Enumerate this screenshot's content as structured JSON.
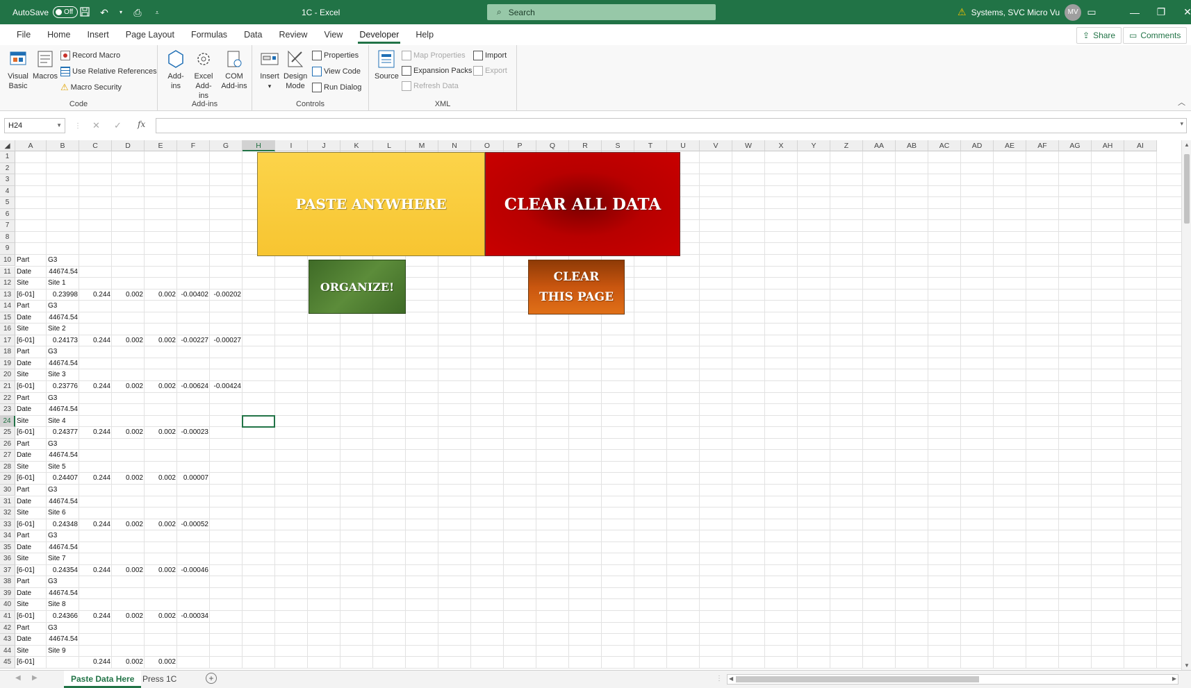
{
  "titlebar": {
    "autosave_label": "AutoSave",
    "autosave_state": "Off",
    "doc_title": "1C  -  Excel",
    "search_placeholder": "Search",
    "account_name": "Systems, SVC Micro Vu",
    "avatar_initials": "MV"
  },
  "menu": {
    "tabs": [
      "File",
      "Home",
      "Insert",
      "Page Layout",
      "Formulas",
      "Data",
      "Review",
      "View",
      "Developer",
      "Help"
    ],
    "active_tab": "Developer",
    "share_label": "Share",
    "comments_label": "Comments"
  },
  "ribbon": {
    "code": {
      "label": "Code",
      "visual_basic": "Visual Basic",
      "macros": "Macros",
      "record_macro": "Record Macro",
      "use_relative": "Use Relative References",
      "macro_security": "Macro Security"
    },
    "addins": {
      "label": "Add-ins",
      "addins": "Add-ins",
      "excel_addins": "Excel Add-ins",
      "com_addins": "COM Add-ins"
    },
    "controls": {
      "label": "Controls",
      "insert": "Insert",
      "design_mode": "Design Mode",
      "properties": "Properties",
      "view_code": "View Code",
      "run_dialog": "Run Dialog"
    },
    "xml": {
      "label": "XML",
      "source": "Source",
      "map_properties": "Map Properties",
      "expansion_packs": "Expansion Packs",
      "refresh_data": "Refresh Data",
      "import": "Import",
      "export": "Export"
    }
  },
  "formula_bar": {
    "name_box": "H24",
    "fx_label": "fx",
    "formula": ""
  },
  "columns": [
    "A",
    "B",
    "C",
    "D",
    "E",
    "F",
    "G",
    "H",
    "I",
    "J",
    "K",
    "L",
    "M",
    "N",
    "O",
    "P",
    "Q",
    "R",
    "S",
    "T",
    "U",
    "V",
    "W",
    "X",
    "Y",
    "Z",
    "AA",
    "AB",
    "AC",
    "AD",
    "AE",
    "AF",
    "AG",
    "AH",
    "AI"
  ],
  "selected_cell": {
    "col": "H",
    "row": 24
  },
  "rows": [
    {
      "n": 1,
      "cells": []
    },
    {
      "n": 2,
      "cells": []
    },
    {
      "n": 3,
      "cells": []
    },
    {
      "n": 4,
      "cells": []
    },
    {
      "n": 5,
      "cells": []
    },
    {
      "n": 6,
      "cells": []
    },
    {
      "n": 7,
      "cells": []
    },
    {
      "n": 8,
      "cells": []
    },
    {
      "n": 9,
      "cells": []
    },
    {
      "n": 10,
      "cells": [
        "Part",
        "G3"
      ]
    },
    {
      "n": 11,
      "cells": [
        "Date",
        "44674.54"
      ]
    },
    {
      "n": 12,
      "cells": [
        "Site",
        "Site 1"
      ]
    },
    {
      "n": 13,
      "cells": [
        "[6-01]",
        "0.23998",
        "0.244",
        "0.002",
        "0.002",
        "-0.00402",
        "-0.00202"
      ]
    },
    {
      "n": 14,
      "cells": [
        "Part",
        "G3"
      ]
    },
    {
      "n": 15,
      "cells": [
        "Date",
        "44674.54"
      ]
    },
    {
      "n": 16,
      "cells": [
        "Site",
        "Site 2"
      ]
    },
    {
      "n": 17,
      "cells": [
        "[6-01]",
        "0.24173",
        "0.244",
        "0.002",
        "0.002",
        "-0.00227",
        "-0.00027"
      ]
    },
    {
      "n": 18,
      "cells": [
        "Part",
        "G3"
      ]
    },
    {
      "n": 19,
      "cells": [
        "Date",
        "44674.54"
      ]
    },
    {
      "n": 20,
      "cells": [
        "Site",
        "Site 3"
      ]
    },
    {
      "n": 21,
      "cells": [
        "[6-01]",
        "0.23776",
        "0.244",
        "0.002",
        "0.002",
        "-0.00624",
        "-0.00424"
      ]
    },
    {
      "n": 22,
      "cells": [
        "Part",
        "G3"
      ]
    },
    {
      "n": 23,
      "cells": [
        "Date",
        "44674.54"
      ]
    },
    {
      "n": 24,
      "cells": [
        "Site",
        "Site 4"
      ]
    },
    {
      "n": 25,
      "cells": [
        "[6-01]",
        "0.24377",
        "0.244",
        "0.002",
        "0.002",
        "-0.00023"
      ]
    },
    {
      "n": 26,
      "cells": [
        "Part",
        "G3"
      ]
    },
    {
      "n": 27,
      "cells": [
        "Date",
        "44674.54"
      ]
    },
    {
      "n": 28,
      "cells": [
        "Site",
        "Site 5"
      ]
    },
    {
      "n": 29,
      "cells": [
        "[6-01]",
        "0.24407",
        "0.244",
        "0.002",
        "0.002",
        "0.00007"
      ]
    },
    {
      "n": 30,
      "cells": [
        "Part",
        "G3"
      ]
    },
    {
      "n": 31,
      "cells": [
        "Date",
        "44674.54"
      ]
    },
    {
      "n": 32,
      "cells": [
        "Site",
        "Site 6"
      ]
    },
    {
      "n": 33,
      "cells": [
        "[6-01]",
        "0.24348",
        "0.244",
        "0.002",
        "0.002",
        "-0.00052"
      ]
    },
    {
      "n": 34,
      "cells": [
        "Part",
        "G3"
      ]
    },
    {
      "n": 35,
      "cells": [
        "Date",
        "44674.54"
      ]
    },
    {
      "n": 36,
      "cells": [
        "Site",
        "Site 7"
      ]
    },
    {
      "n": 37,
      "cells": [
        "[6-01]",
        "0.24354",
        "0.244",
        "0.002",
        "0.002",
        "-0.00046"
      ]
    },
    {
      "n": 38,
      "cells": [
        "Part",
        "G3"
      ]
    },
    {
      "n": 39,
      "cells": [
        "Date",
        "44674.54"
      ]
    },
    {
      "n": 40,
      "cells": [
        "Site",
        "Site 8"
      ]
    },
    {
      "n": 41,
      "cells": [
        "[6-01]",
        "0.24366",
        "0.244",
        "0.002",
        "0.002",
        "-0.00034"
      ]
    },
    {
      "n": 42,
      "cells": [
        "Part",
        "G3"
      ]
    },
    {
      "n": 43,
      "cells": [
        "Date",
        "44674.54"
      ]
    },
    {
      "n": 44,
      "cells": [
        "Site",
        "Site 9"
      ]
    },
    {
      "n": 45,
      "cells": [
        "[6-01]",
        "",
        "0.244",
        "0.002",
        "0.002"
      ]
    }
  ],
  "shapes": {
    "paste_anywhere": {
      "label": "PASTE ANYWHERE",
      "color": "#f9c83a"
    },
    "clear_all_data": {
      "label": "CLEAR ALL DATA",
      "color": "#b80000"
    },
    "organize": {
      "label": "ORGANIZE!",
      "color": "#4c7a31"
    },
    "clear_this_page": {
      "label": "CLEAR\nTHIS PAGE",
      "color": "#c35a12"
    }
  },
  "sheets": {
    "tabs": [
      "Paste Data Here",
      "Press 1C"
    ],
    "active": "Paste Data Here"
  },
  "colors": {
    "accent": "#217346"
  }
}
